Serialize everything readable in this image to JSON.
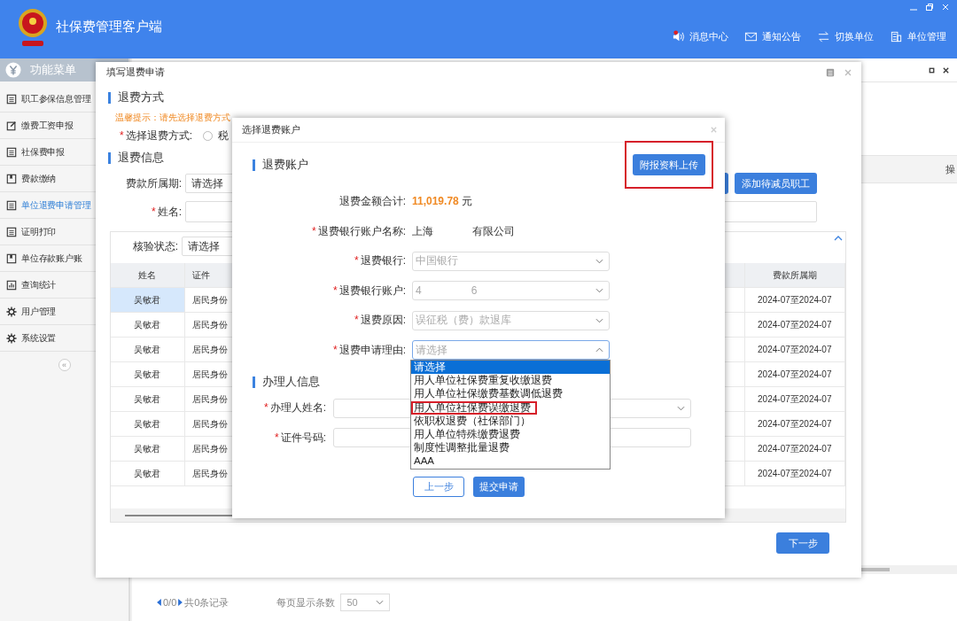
{
  "app": {
    "title": "社保费管理客户端",
    "nav": [
      {
        "kind": "message",
        "label": "消息中心",
        "alert": true
      },
      {
        "kind": "notice",
        "label": "通知公告",
        "alert": false
      },
      {
        "kind": "switch",
        "label": "切换单位",
        "alert": false
      },
      {
        "kind": "unit",
        "label": "单位管理",
        "alert": false
      }
    ]
  },
  "sidebar": {
    "title": "功能菜单",
    "items": [
      {
        "kind": "list",
        "label": "职工参保信息管理",
        "selected": false
      },
      {
        "kind": "edit",
        "label": "缴费工资申报",
        "selected": false
      },
      {
        "kind": "clipboard",
        "label": "社保费申报",
        "selected": false
      },
      {
        "kind": "book",
        "label": "费款缴纳",
        "selected": false
      },
      {
        "kind": "list",
        "label": "单位退费申请管理",
        "selected": true
      },
      {
        "kind": "print",
        "label": "证明打印",
        "selected": false
      },
      {
        "kind": "book",
        "label": "单位存款账户账",
        "selected": false
      },
      {
        "kind": "chart",
        "label": "查询统计",
        "selected": false
      },
      {
        "kind": "gear",
        "label": "用户管理",
        "selected": false
      },
      {
        "kind": "gear",
        "label": "系统设置",
        "selected": false
      }
    ],
    "collapse": "«"
  },
  "page": {
    "column_header": "操",
    "pagination": {
      "current": "0/0",
      "total": "共0条记录",
      "page_size_label": "每页显示条数",
      "page_size": "50"
    }
  },
  "apply_dialog": {
    "title": "填写退费申请",
    "section_method": "退费方式",
    "tip": "温馨提示：请先选择退费方式",
    "method_mark": "*",
    "method_label": "选择退费方式:",
    "method_checked": false,
    "method_option": "税",
    "section_info": "退费信息",
    "period_label": "费款所属期:",
    "period_value": "请选择",
    "name_mark": "*",
    "name_label": "姓名:",
    "add_button": "添加待减员职工",
    "status_label": "核验状态:",
    "status_value": "请选择",
    "table": {
      "columns": [
        "姓名",
        "证件",
        "",
        "费款所属期"
      ],
      "rows": [
        {
          "name": "吴敏君",
          "id_type": "居民身份",
          "period": "2024-07至2024-07",
          "selected": true
        },
        {
          "name": "吴敏君",
          "id_type": "居民身份",
          "period": "2024-07至2024-07",
          "selected": false
        },
        {
          "name": "吴敏君",
          "id_type": "居民身份",
          "period": "2024-07至2024-07",
          "selected": false
        },
        {
          "name": "吴敏君",
          "id_type": "居民身份",
          "period": "2024-07至2024-07",
          "selected": false
        },
        {
          "name": "吴敏君",
          "id_type": "居民身份",
          "period": "2024-07至2024-07",
          "selected": false
        },
        {
          "name": "吴敏君",
          "id_type": "居民身份",
          "period": "2024-07至2024-07",
          "selected": false
        },
        {
          "name": "吴敏君",
          "id_type": "居民身份",
          "period": "2024-07至2024-07",
          "selected": false
        },
        {
          "name": "吴敏君",
          "id_type": "居民身份",
          "period": "2024-07至2024-07",
          "selected": false
        }
      ]
    },
    "next_button": "下一步"
  },
  "account_dialog": {
    "title": "选择退费账户",
    "section_account": "退费账户",
    "upload_button": {
      "label": "附报资料上传",
      "highlighted": true
    },
    "amount_label": "退费金额合计:",
    "amount": "11,019.78",
    "amount_unit": "元",
    "fields": [
      {
        "kind": "text",
        "mark": "*",
        "label": "退费银行账户名称:",
        "parts": [
          "上海",
          "有限公司"
        ]
      },
      {
        "kind": "select",
        "mark": "*",
        "label": "退费银行:",
        "parts": [
          "中国银行"
        ],
        "disabled": true,
        "expanded": false
      },
      {
        "kind": "select",
        "mark": "*",
        "label": "退费银行账户:",
        "parts": [
          "4",
          "6"
        ],
        "disabled": true,
        "expanded": false
      },
      {
        "kind": "select",
        "mark": "*",
        "label": "退费原因:",
        "parts": [
          "误征税（费）款退库"
        ],
        "disabled": true,
        "expanded": false
      },
      {
        "kind": "select",
        "mark": "*",
        "label": "退费申请理由:",
        "parts": [
          "请选择"
        ],
        "disabled": false,
        "expanded": true
      }
    ],
    "options": [
      {
        "label": "请选择",
        "selected": true,
        "highlighted": false
      },
      {
        "label": "用人单位社保费重复收缴退费",
        "selected": false,
        "highlighted": false
      },
      {
        "label": "用人单位社保缴费基数调低退费",
        "selected": false,
        "highlighted": false
      },
      {
        "label": "用人单位社保费误缴退费",
        "selected": false,
        "highlighted": true
      },
      {
        "label": "依职权退费（社保部门）",
        "selected": false,
        "highlighted": false
      },
      {
        "label": "用人单位特殊缴费退费",
        "selected": false,
        "highlighted": false
      },
      {
        "label": "制度性调整批量退费",
        "selected": false,
        "highlighted": false
      },
      {
        "label": "AAA",
        "selected": false,
        "highlighted": false
      }
    ],
    "section_handler": "办理人信息",
    "handler_name_mark": "*",
    "handler_name_label": "办理人姓名:",
    "handler_id_mark": "*",
    "handler_id_label": "证件号码:",
    "back_button": "上一步",
    "submit_button": "提交申请"
  }
}
